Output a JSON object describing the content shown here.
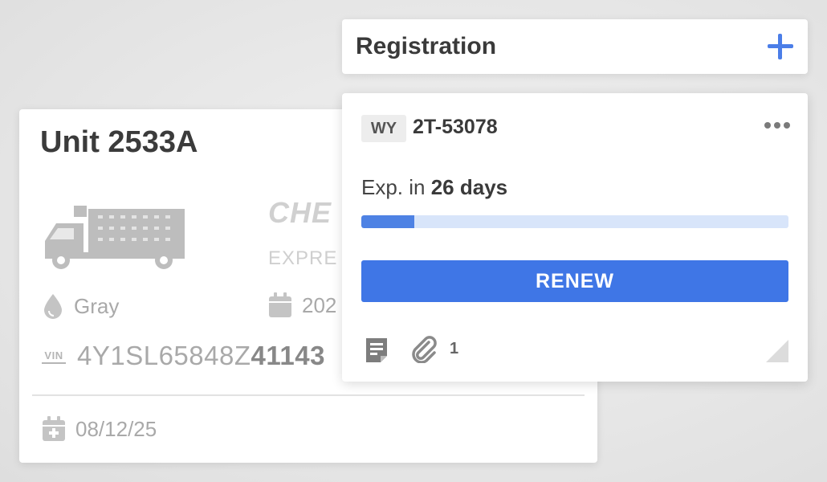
{
  "unit": {
    "title": "Unit 2533A",
    "brand": "CHE",
    "brand_sub": "EXPRE",
    "color": "Gray",
    "year": "202",
    "vin_prefix": "VIN",
    "vin_light": "4Y1SL65848Z",
    "vin_dark": "41143",
    "date": "08/12/25"
  },
  "registration": {
    "title": "Registration",
    "state": "WY",
    "plate": "2T-53078",
    "expiry_prefix": "Exp. in ",
    "expiry_days": "26 days",
    "progress": 0.124,
    "renew_label": "RENEW",
    "attachment_count": "1"
  },
  "icons": [
    "truck-icon",
    "color-drop-icon",
    "calendar-icon",
    "vin-icon",
    "calendar-add-icon",
    "add-icon",
    "more-icon",
    "notes-icon",
    "paperclip-icon",
    "resize-handle-icon"
  ],
  "colors": {
    "accent": "#3f76e6",
    "progress_track": "#d8e5fa",
    "text_dark": "#3a3a3a",
    "muted": "#a9a9a9"
  }
}
